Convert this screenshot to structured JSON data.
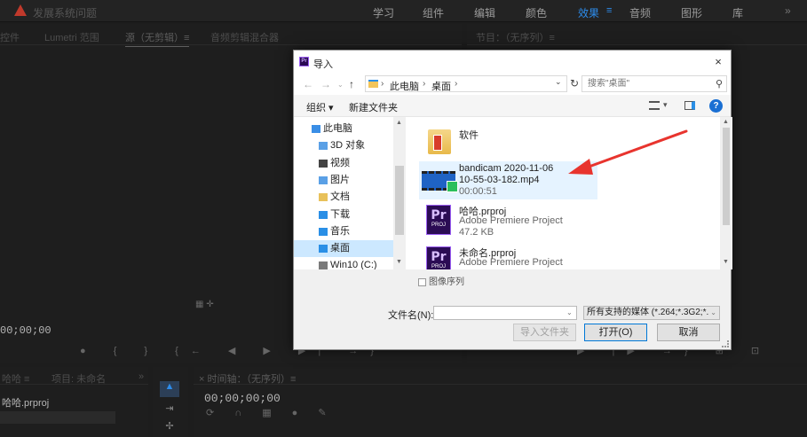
{
  "premiere": {
    "project_name": "发展系统问题",
    "workspaces": [
      "学习",
      "组件",
      "编辑",
      "颜色",
      "效果",
      "音频",
      "图形",
      "库"
    ],
    "active_workspace": "效果",
    "workspace_menu": "≡",
    "more": "»",
    "source_tabs": [
      "控件",
      "Lumetri 范围",
      "源（无剪辑）≡",
      "音频剪辑混合器"
    ],
    "program_tab": "节目：（无序列）≡",
    "timecode_left": "00;00;00",
    "project_tabs": [
      "哈哈 ≡",
      "项目: 未命名",
      "»"
    ],
    "project_file": "哈哈.prproj",
    "timeline_tab": "× 时间轴：（无序列）≡",
    "timeline_timecode": "00;00;00;00"
  },
  "dialog": {
    "title": "导入",
    "close": "×",
    "breadcrumb": [
      "此电脑",
      "桌面"
    ],
    "search_placeholder": "搜索\"桌面\"",
    "toolbar": {
      "organize": "组织 ▾",
      "new_folder": "新建文件夹",
      "help": "?"
    },
    "nav_items": [
      {
        "label": "此电脑",
        "icon": "pc-icon",
        "color": "#3a8ee6",
        "indent": 20
      },
      {
        "label": "3D 对象",
        "icon": "3d-objects-icon",
        "color": "#5aa0e6",
        "indent": 28
      },
      {
        "label": "视频",
        "icon": "video-folder-icon",
        "color": "#444444",
        "indent": 28
      },
      {
        "label": "图片",
        "icon": "pictures-folder-icon",
        "color": "#5aa0e6",
        "indent": 28
      },
      {
        "label": "文档",
        "icon": "documents-folder-icon",
        "color": "#e8c15a",
        "indent": 28
      },
      {
        "label": "下载",
        "icon": "downloads-folder-icon",
        "color": "#2a8fe6",
        "indent": 28
      },
      {
        "label": "音乐",
        "icon": "music-folder-icon",
        "color": "#2a8fe6",
        "indent": 28
      },
      {
        "label": "桌面",
        "icon": "desktop-folder-icon",
        "color": "#2a8fe6",
        "indent": 28,
        "selected": true
      },
      {
        "label": "Win10 (C:)",
        "icon": "drive-icon",
        "color": "#7a7a7a",
        "indent": 28
      }
    ],
    "files": [
      {
        "name": "软件",
        "type": "folder"
      },
      {
        "name": "bandicam 2020-11-06",
        "name2": "10-55-03-182.mp4",
        "sub": "00:00:51",
        "type": "video",
        "selected": true
      },
      {
        "name": "哈哈.prproj",
        "sub": "Adobe Premiere Project",
        "sub2": "47.2 KB",
        "type": "project"
      },
      {
        "name": "未命名.prproj",
        "sub": "Adobe Premiere Project",
        "type": "project"
      }
    ],
    "project_icon_text": "Pr",
    "project_icon_sub": "PROJ",
    "image_sequence": "图像序列",
    "filename_label": "文件名(N):",
    "filename_value": "",
    "filter": "所有支持的媒体 (*.264;*.3G2;*.",
    "buttons": {
      "import_folder": "导入文件夹",
      "open": "打开(O)",
      "cancel": "取消"
    }
  },
  "colors": {
    "accent": "#2d8ceb",
    "selection": "#cce8ff",
    "annotation": "#e8342e"
  }
}
